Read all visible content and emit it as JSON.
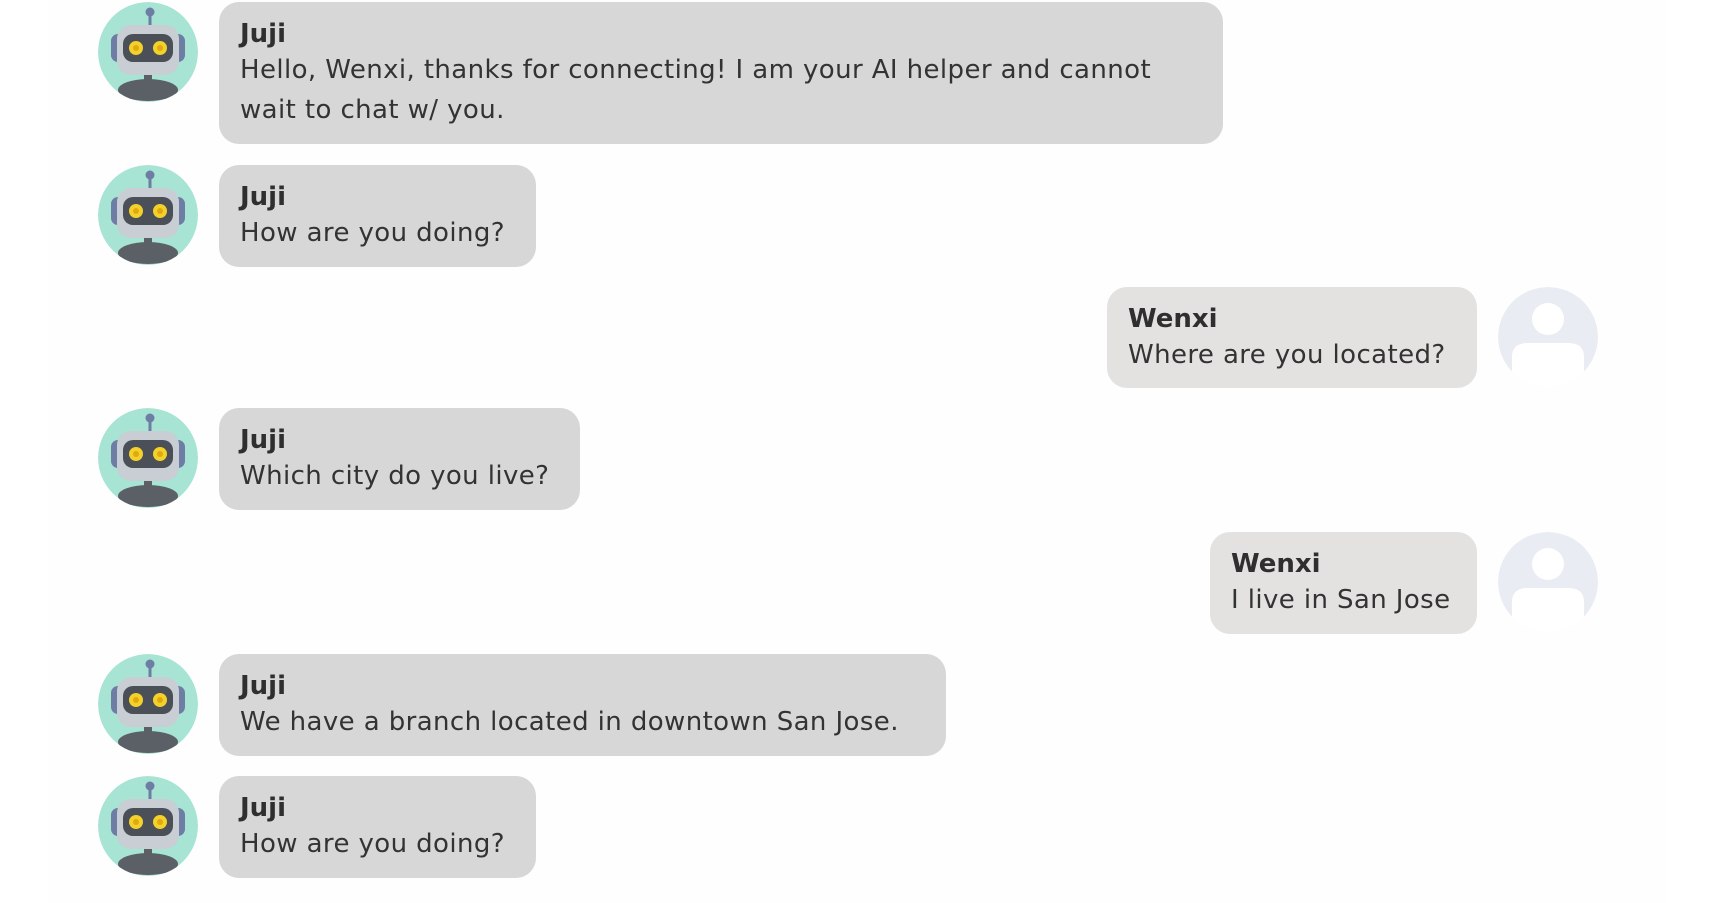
{
  "bot": {
    "name": "Juji",
    "avatar_icon": "robot-avatar-icon"
  },
  "user": {
    "name": "Wenxi",
    "avatar_icon": "user-placeholder-avatar-icon"
  },
  "colors": {
    "bot_bubble": "#d7d7d7",
    "user_bubble": "#e4e1e1",
    "bot_avatar_bg": "#a8e4d3",
    "user_avatar_bg": "#e9ecf3"
  },
  "messages": [
    {
      "sender": "Juji",
      "role": "bot",
      "text": "Hello, Wenxi, thanks for connecting! I am your AI helper and cannot wait to chat w/ you."
    },
    {
      "sender": "Juji",
      "role": "bot",
      "text": "How are you doing?"
    },
    {
      "sender": "Wenxi",
      "role": "user",
      "text": "Where are you located?"
    },
    {
      "sender": "Juji",
      "role": "bot",
      "text": "Which city do you live?"
    },
    {
      "sender": "Wenxi",
      "role": "user",
      "text": "I live in San Jose"
    },
    {
      "sender": "Juji",
      "role": "bot",
      "text": "We have a branch located in downtown San Jose."
    },
    {
      "sender": "Juji",
      "role": "bot",
      "text": "How are you doing?"
    }
  ]
}
